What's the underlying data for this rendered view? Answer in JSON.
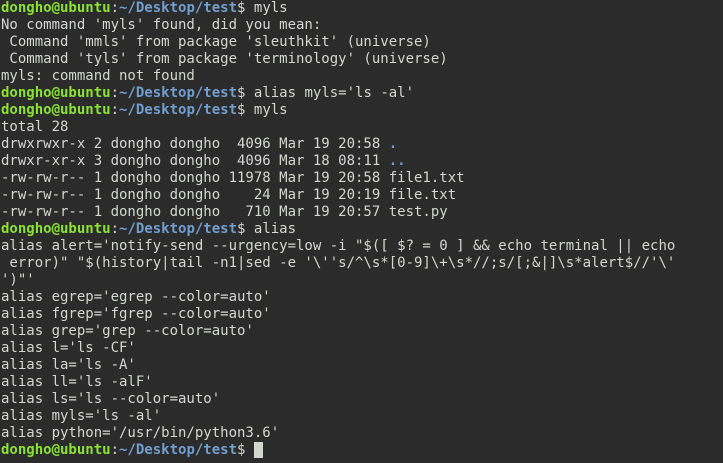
{
  "theme": {
    "background": "#2b2b2b",
    "text": "#d3d7cf",
    "prompt_user": "#8ae234",
    "prompt_path": "#729fcf"
  },
  "prompt": {
    "user_host": "dongho@ubuntu",
    "sep": ":",
    "path": "~/Desktop/test",
    "symbol": "$"
  },
  "lines": [
    {
      "type": "prompt",
      "cmd": " myls"
    },
    {
      "type": "out",
      "text": "No command 'myls' found, did you mean:"
    },
    {
      "type": "out",
      "text": " Command 'mmls' from package 'sleuthkit' (universe)"
    },
    {
      "type": "out",
      "text": " Command 'tyls' from package 'terminology' (universe)"
    },
    {
      "type": "out",
      "text": "myls: command not found"
    },
    {
      "type": "prompt",
      "cmd": " alias myls='ls -al'"
    },
    {
      "type": "prompt",
      "cmd": " myls"
    },
    {
      "type": "out",
      "text": "total 28"
    },
    {
      "type": "ls",
      "text": "drwxrwxr-x 2 dongho dongho  4096 Mar 19 20:58 ",
      "name": "."
    },
    {
      "type": "ls",
      "text": "drwxr-xr-x 3 dongho dongho  4096 Mar 18 08:11 ",
      "name": ".."
    },
    {
      "type": "out",
      "text": "-rw-rw-r-- 1 dongho dongho 11978 Mar 19 20:58 file1.txt"
    },
    {
      "type": "out",
      "text": "-rw-rw-r-- 1 dongho dongho    24 Mar 19 20:19 file.txt"
    },
    {
      "type": "out",
      "text": "-rw-rw-r-- 1 dongho dongho   710 Mar 19 20:57 test.py"
    },
    {
      "type": "prompt",
      "cmd": " alias"
    },
    {
      "type": "out",
      "text": "alias alert='notify-send --urgency=low -i \"$([ $? = 0 ] && echo terminal || echo"
    },
    {
      "type": "out",
      "text": " error)\" \"$(history|tail -n1|sed -e '\\''s/^\\s*[0-9]\\+\\s*//;s/[;&|]\\s*alert$//'\\'"
    },
    {
      "type": "out",
      "text": "')\"'"
    },
    {
      "type": "out",
      "text": "alias egrep='egrep --color=auto'"
    },
    {
      "type": "out",
      "text": "alias fgrep='fgrep --color=auto'"
    },
    {
      "type": "out",
      "text": "alias grep='grep --color=auto'"
    },
    {
      "type": "out",
      "text": "alias l='ls -CF'"
    },
    {
      "type": "out",
      "text": "alias la='ls -A'"
    },
    {
      "type": "out",
      "text": "alias ll='ls -alF'"
    },
    {
      "type": "out",
      "text": "alias ls='ls --color=auto'"
    },
    {
      "type": "out",
      "text": "alias myls='ls -al'"
    },
    {
      "type": "out",
      "text": "alias python='/usr/bin/python3.6'"
    },
    {
      "type": "prompt",
      "cmd": " ",
      "cursor": true
    }
  ]
}
